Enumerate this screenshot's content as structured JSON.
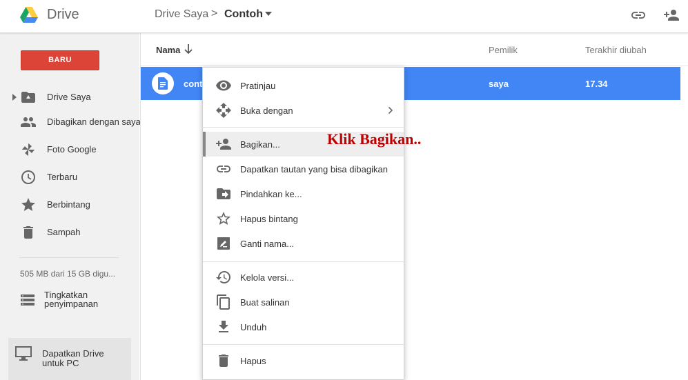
{
  "header": {
    "app_title": "Drive",
    "breadcrumb_root": "Drive Saya",
    "breadcrumb_separator": ">",
    "breadcrumb_current": "Contoh"
  },
  "sidebar": {
    "new_button": "BARU",
    "items": [
      {
        "label": "Drive Saya",
        "icon": "my-drive-icon"
      },
      {
        "label": "Dibagikan dengan saya",
        "icon": "people-icon"
      },
      {
        "label": "Foto Google",
        "icon": "pinwheel-icon"
      },
      {
        "label": "Terbaru",
        "icon": "clock-icon"
      },
      {
        "label": "Berbintang",
        "icon": "star-icon"
      },
      {
        "label": "Sampah",
        "icon": "trash-icon"
      }
    ],
    "storage": "505 MB dari 15 GB digu...",
    "upgrade_storage": "Tingkatkan penyimpanan",
    "get_drive_pc": "Dapatkan Drive untuk PC"
  },
  "list": {
    "col_name": "Nama",
    "col_owner": "Pemilik",
    "col_modified": "Terakhir diubah",
    "rows": [
      {
        "name": "conto",
        "owner": "saya",
        "modified": "17.34"
      }
    ]
  },
  "context_menu": {
    "items": [
      {
        "label": "Pratinjau",
        "icon": "eye-icon"
      },
      {
        "label": "Buka dengan",
        "icon": "open-with-icon"
      },
      {
        "label": "Bagikan...",
        "icon": "person-add-icon"
      },
      {
        "label": "Dapatkan tautan yang bisa dibagikan",
        "icon": "link-icon"
      },
      {
        "label": "Pindahkan ke...",
        "icon": "move-folder-icon"
      },
      {
        "label": "Hapus bintang",
        "icon": "star-outline-icon"
      },
      {
        "label": "Ganti nama...",
        "icon": "rename-icon"
      },
      {
        "label": "Kelola versi...",
        "icon": "history-icon"
      },
      {
        "label": "Buat salinan",
        "icon": "copy-icon"
      },
      {
        "label": "Unduh",
        "icon": "download-icon"
      },
      {
        "label": "Hapus",
        "icon": "trash-icon"
      }
    ]
  },
  "annotation": "Klik Bagikan..",
  "colors": {
    "accent_blue": "#4285f4",
    "new_button_red": "#db4437",
    "annotation_red": "#c00000"
  }
}
